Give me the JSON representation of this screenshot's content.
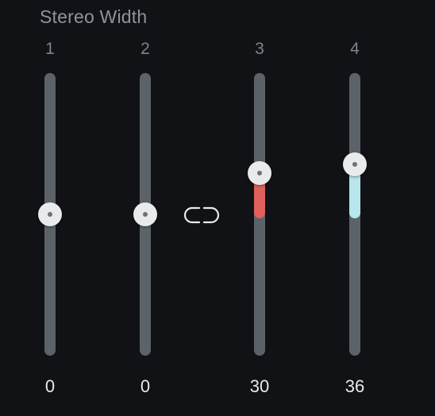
{
  "title": "Stereo Width",
  "channels": [
    {
      "label": "1",
      "value": "0",
      "level": 0,
      "fill_color": null
    },
    {
      "label": "2",
      "value": "0",
      "level": 0,
      "fill_color": null
    },
    {
      "label": "3",
      "value": "30",
      "level": 30,
      "fill_color": "#e0605c"
    },
    {
      "label": "4",
      "value": "36",
      "level": 36,
      "fill_color": "#b7e6ec"
    }
  ],
  "range": [
    -100,
    100
  ],
  "link_icon": "link-icon",
  "colors": {
    "background": "#111215",
    "track": "#5b6369",
    "thumb": "#e9eaeb",
    "value_text": "#e8e9ea"
  }
}
